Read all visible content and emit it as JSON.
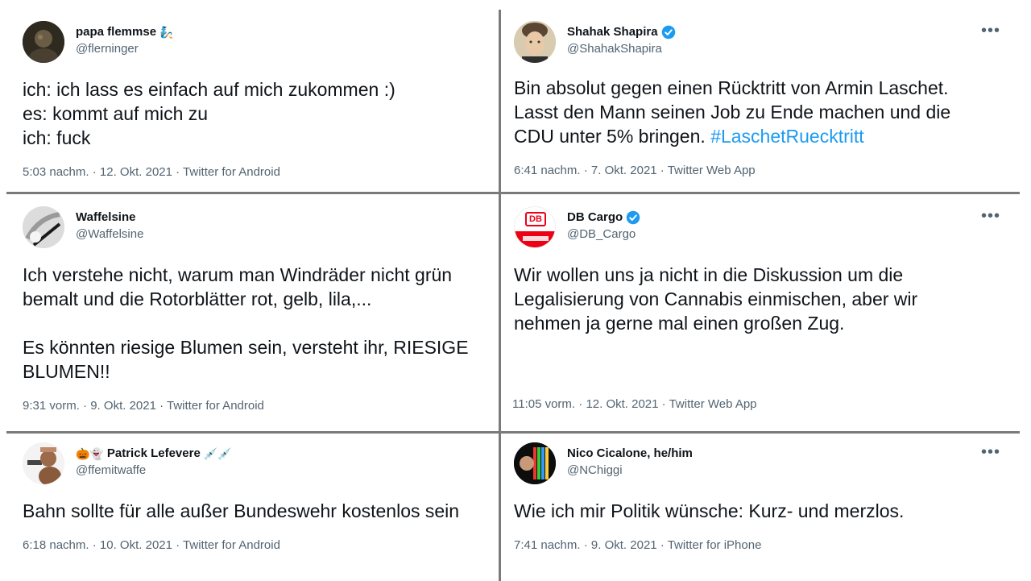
{
  "tweets": [
    {
      "name": "papa flemmse",
      "name_emoji": "🧞",
      "handle": "@flerninger",
      "text": "ich: ich lass es einfach auf mich zukommen :)\nes: kommt auf mich zu\nich: fuck",
      "time": "5:03 nachm.",
      "date": "12. Okt. 2021",
      "source": "Twitter for Android"
    },
    {
      "name": "Shahak Shapira",
      "verified": true,
      "handle": "@ShahakShapira",
      "text": "Bin absolut gegen einen Rücktritt von Armin Laschet.\nLasst den Mann seinen Job zu Ende machen und die\nCDU unter 5% bringen. ",
      "hashtag": "#LaschetRuecktritt",
      "time": "6:41 nachm.",
      "date": "7. Okt. 2021",
      "source": "Twitter Web App",
      "more": "•••"
    },
    {
      "name": "Waffelsine",
      "handle": "@Waffelsine",
      "text": "Ich verstehe nicht, warum man Windräder nicht grün\nbemalt und die Rotorblätter rot, gelb, lila,...\n\nEs könnten riesige Blumen sein, versteht ihr, RIESIGE\nBLUMEN!!",
      "time": "9:31 vorm.",
      "date": "9. Okt. 2021",
      "source": "Twitter for Android"
    },
    {
      "name": "DB Cargo",
      "verified": true,
      "handle": "@DB_Cargo",
      "avatar_text": "DB",
      "text": "Wir wollen uns ja nicht in die Diskussion um die\nLegalisierung von Cannabis einmischen, aber wir\nnehmen ja gerne mal einen großen Zug.",
      "time": "11:05 vorm.",
      "date": "12. Okt. 2021",
      "source": "Twitter Web App",
      "more": "•••"
    },
    {
      "name": "Patrick Lefevere",
      "name_prefix": "🎃👻",
      "name_suffix": "💉💉",
      "handle": "@ffemitwaffe",
      "text": "Bahn sollte für alle außer Bundeswehr kostenlos sein",
      "time": "6:18 nachm.",
      "date": "10. Okt. 2021",
      "source": "Twitter for Android"
    },
    {
      "name": "Nico Cicalone, he/him",
      "handle": "@NChiggi",
      "text": "Wie ich mir Politik wünsche: Kurz- und merzlos.",
      "time": "7:41 nachm.",
      "date": "9. Okt. 2021",
      "source": "Twitter for iPhone",
      "more": "•••"
    }
  ],
  "separator": " · ",
  "colors": {
    "text": "#0f1419",
    "secondary": "#536471",
    "link": "#1d9bf0",
    "verified": "#1d9bf0",
    "db_red": "#ec0016",
    "divider": "#7a7a7a"
  }
}
